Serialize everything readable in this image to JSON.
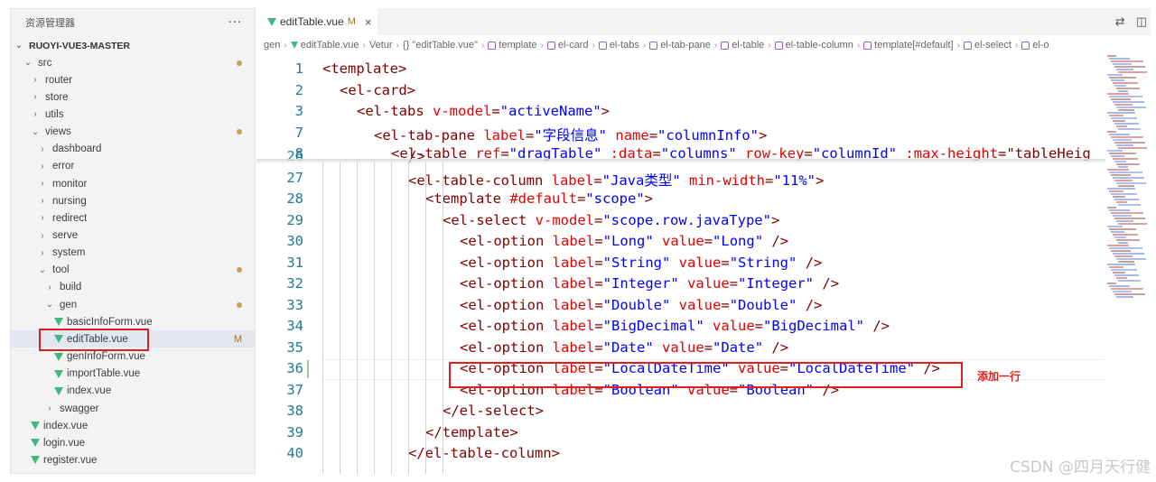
{
  "sidebar": {
    "title": "资源管理器",
    "more_label": "···",
    "project": "RUOYI-VUE3-MASTER",
    "items": [
      {
        "label": "src",
        "type": "folder",
        "open": true,
        "depth": 0,
        "dot": true
      },
      {
        "label": "router",
        "type": "folder",
        "open": false,
        "depth": 1
      },
      {
        "label": "store",
        "type": "folder",
        "open": false,
        "depth": 1
      },
      {
        "label": "utils",
        "type": "folder",
        "open": false,
        "depth": 1
      },
      {
        "label": "views",
        "type": "folder",
        "open": true,
        "depth": 1,
        "dot": true
      },
      {
        "label": "dashboard",
        "type": "folder",
        "open": false,
        "depth": 2
      },
      {
        "label": "error",
        "type": "folder",
        "open": false,
        "depth": 2
      },
      {
        "label": "monitor",
        "type": "folder",
        "open": false,
        "depth": 2
      },
      {
        "label": "nursing",
        "type": "folder",
        "open": false,
        "depth": 2
      },
      {
        "label": "redirect",
        "type": "folder",
        "open": false,
        "depth": 2
      },
      {
        "label": "serve",
        "type": "folder",
        "open": false,
        "depth": 2
      },
      {
        "label": "system",
        "type": "folder",
        "open": false,
        "depth": 2
      },
      {
        "label": "tool",
        "type": "folder",
        "open": true,
        "depth": 2,
        "dot": true
      },
      {
        "label": "build",
        "type": "folder",
        "open": false,
        "depth": 3
      },
      {
        "label": "gen",
        "type": "folder",
        "open": true,
        "depth": 3,
        "dot": true
      },
      {
        "label": "basicInfoForm.vue",
        "type": "vue",
        "depth": 4
      },
      {
        "label": "editTable.vue",
        "type": "vue",
        "depth": 4,
        "selected": true,
        "flag": "M"
      },
      {
        "label": "genInfoForm.vue",
        "type": "vue",
        "depth": 4
      },
      {
        "label": "importTable.vue",
        "type": "vue",
        "depth": 4
      },
      {
        "label": "index.vue",
        "type": "vue",
        "depth": 4
      },
      {
        "label": "swagger",
        "type": "folder",
        "open": false,
        "depth": 3
      },
      {
        "label": "index.vue",
        "type": "vue",
        "depth": 2
      },
      {
        "label": "login.vue",
        "type": "vue",
        "depth": 2
      },
      {
        "label": "register.vue",
        "type": "vue",
        "depth": 2
      }
    ]
  },
  "editor": {
    "tab": {
      "label": "editTable.vue",
      "modified": "M",
      "close": "×"
    },
    "actions": [
      "⇄",
      "◫"
    ],
    "breadcrumb": [
      "gen",
      "editTable.vue",
      "Vetur",
      "{} \"editTable.vue\"",
      "template",
      "el-card",
      "el-tabs",
      "el-tab-pane",
      "el-table",
      "el-table-column",
      "template[#default]",
      "el-select",
      "el-o"
    ],
    "sticky_lines": [
      {
        "num": "1",
        "indent": 0,
        "tokens": [
          [
            "t",
            "<template>"
          ]
        ]
      },
      {
        "num": "2",
        "indent": 1,
        "tokens": [
          [
            "t",
            "<el-card>"
          ]
        ]
      },
      {
        "num": "3",
        "indent": 2,
        "tokens": [
          [
            "t",
            "<el-tabs "
          ],
          [
            "a",
            "v-model"
          ],
          [
            "p",
            "="
          ],
          [
            "s",
            "\"activeName\""
          ],
          [
            "t",
            ">"
          ]
        ]
      },
      {
        "num": "7",
        "indent": 3,
        "tokens": [
          [
            "t",
            "<el-tab-pane "
          ],
          [
            "a",
            "label"
          ],
          [
            "p",
            "="
          ],
          [
            "s",
            "\"字段信息\""
          ],
          [
            "p",
            " "
          ],
          [
            "a",
            "name"
          ],
          [
            "p",
            "="
          ],
          [
            "s",
            "\"columnInfo\""
          ],
          [
            "t",
            ">"
          ]
        ]
      },
      {
        "num": "8",
        "indent": 4,
        "tokens": [
          [
            "t",
            "<el-table "
          ],
          [
            "a",
            "ref"
          ],
          [
            "p",
            "="
          ],
          [
            "s",
            "\"dragTable\""
          ],
          [
            "p",
            " "
          ],
          [
            "a",
            ":data"
          ],
          [
            "p",
            "="
          ],
          [
            "s",
            "\"columns\""
          ],
          [
            "p",
            " "
          ],
          [
            "a",
            "row-key"
          ],
          [
            "p",
            "="
          ],
          [
            "s",
            "\"columnId\""
          ],
          [
            "p",
            " "
          ],
          [
            "a",
            ":max-height"
          ],
          [
            "p",
            "="
          ],
          [
            "p",
            "\"tableHeig"
          ]
        ]
      }
    ],
    "lines": [
      {
        "num": "26",
        "indent": 5,
        "tokens": [
          [
            "t",
            "/>"
          ]
        ]
      },
      {
        "num": "27",
        "indent": 5,
        "tokens": [
          [
            "t",
            "<el-table-column "
          ],
          [
            "a",
            "label"
          ],
          [
            "p",
            "="
          ],
          [
            "s",
            "\"Java类型\""
          ],
          [
            "p",
            " "
          ],
          [
            "a",
            "min-width"
          ],
          [
            "p",
            "="
          ],
          [
            "s",
            "\"11%\""
          ],
          [
            "t",
            ">"
          ]
        ]
      },
      {
        "num": "28",
        "indent": 6,
        "tokens": [
          [
            "t",
            "<template "
          ],
          [
            "a",
            "#default"
          ],
          [
            "p",
            "="
          ],
          [
            "s",
            "\"scope\""
          ],
          [
            "t",
            ">"
          ]
        ]
      },
      {
        "num": "29",
        "indent": 7,
        "tokens": [
          [
            "t",
            "<el-select "
          ],
          [
            "a",
            "v-model"
          ],
          [
            "p",
            "="
          ],
          [
            "s",
            "\"scope.row.javaType\""
          ],
          [
            "t",
            ">"
          ]
        ]
      },
      {
        "num": "30",
        "indent": 8,
        "tokens": [
          [
            "t",
            "<el-option "
          ],
          [
            "a",
            "label"
          ],
          [
            "p",
            "="
          ],
          [
            "s",
            "\"Long\""
          ],
          [
            "p",
            " "
          ],
          [
            "a",
            "value"
          ],
          [
            "p",
            "="
          ],
          [
            "s",
            "\"Long\""
          ],
          [
            "p",
            " "
          ],
          [
            "t",
            "/>"
          ]
        ]
      },
      {
        "num": "31",
        "indent": 8,
        "tokens": [
          [
            "t",
            "<el-option "
          ],
          [
            "a",
            "label"
          ],
          [
            "p",
            "="
          ],
          [
            "s",
            "\"String\""
          ],
          [
            "p",
            " "
          ],
          [
            "a",
            "value"
          ],
          [
            "p",
            "="
          ],
          [
            "s",
            "\"String\""
          ],
          [
            "p",
            " "
          ],
          [
            "t",
            "/>"
          ]
        ]
      },
      {
        "num": "32",
        "indent": 8,
        "tokens": [
          [
            "t",
            "<el-option "
          ],
          [
            "a",
            "label"
          ],
          [
            "p",
            "="
          ],
          [
            "s",
            "\"Integer\""
          ],
          [
            "p",
            " "
          ],
          [
            "a",
            "value"
          ],
          [
            "p",
            "="
          ],
          [
            "s",
            "\"Integer\""
          ],
          [
            "p",
            " "
          ],
          [
            "t",
            "/>"
          ]
        ]
      },
      {
        "num": "33",
        "indent": 8,
        "tokens": [
          [
            "t",
            "<el-option "
          ],
          [
            "a",
            "label"
          ],
          [
            "p",
            "="
          ],
          [
            "s",
            "\"Double\""
          ],
          [
            "p",
            " "
          ],
          [
            "a",
            "value"
          ],
          [
            "p",
            "="
          ],
          [
            "s",
            "\"Double\""
          ],
          [
            "p",
            " "
          ],
          [
            "t",
            "/>"
          ]
        ]
      },
      {
        "num": "34",
        "indent": 8,
        "tokens": [
          [
            "t",
            "<el-option "
          ],
          [
            "a",
            "label"
          ],
          [
            "p",
            "="
          ],
          [
            "s",
            "\"BigDecimal\""
          ],
          [
            "p",
            " "
          ],
          [
            "a",
            "value"
          ],
          [
            "p",
            "="
          ],
          [
            "s",
            "\"BigDecimal\""
          ],
          [
            "p",
            " "
          ],
          [
            "t",
            "/>"
          ]
        ]
      },
      {
        "num": "35",
        "indent": 8,
        "tokens": [
          [
            "t",
            "<el-option "
          ],
          [
            "a",
            "label"
          ],
          [
            "p",
            "="
          ],
          [
            "s",
            "\"Date\""
          ],
          [
            "p",
            " "
          ],
          [
            "a",
            "value"
          ],
          [
            "p",
            "="
          ],
          [
            "s",
            "\"Date\""
          ],
          [
            "p",
            " "
          ],
          [
            "t",
            "/>"
          ]
        ]
      },
      {
        "num": "36",
        "indent": 8,
        "tokens": [
          [
            "t",
            "<el-option "
          ],
          [
            "a",
            "label"
          ],
          [
            "p",
            "="
          ],
          [
            "s",
            "\"LocalDateTime\""
          ],
          [
            "p",
            " "
          ],
          [
            "a",
            "value"
          ],
          [
            "p",
            "="
          ],
          [
            "s",
            "\"LocalDateTime\""
          ],
          [
            "p",
            " "
          ],
          [
            "t",
            "/>"
          ]
        ],
        "current": true,
        "highlight": true
      },
      {
        "num": "37",
        "indent": 8,
        "tokens": [
          [
            "t",
            "<el-option "
          ],
          [
            "a",
            "label"
          ],
          [
            "p",
            "="
          ],
          [
            "s",
            "\"Boolean\""
          ],
          [
            "p",
            " "
          ],
          [
            "a",
            "value"
          ],
          [
            "p",
            "="
          ],
          [
            "s",
            "\"Boolean\""
          ],
          [
            "p",
            " "
          ],
          [
            "t",
            "/>"
          ]
        ]
      },
      {
        "num": "38",
        "indent": 7,
        "tokens": [
          [
            "t",
            "</el-select>"
          ]
        ]
      },
      {
        "num": "39",
        "indent": 6,
        "tokens": [
          [
            "t",
            "</template>"
          ]
        ]
      },
      {
        "num": "40",
        "indent": 5,
        "tokens": [
          [
            "t",
            "</el-table-column>"
          ]
        ]
      }
    ]
  },
  "annotation": "添加一行",
  "watermark": "CSDN @四月天行健",
  "colors": {
    "tag": "#800000",
    "attr": "#e50000",
    "string": "#0000ff",
    "line_number": "#237893",
    "highlight_box": "#e02020",
    "vue_icon": "#41b883"
  }
}
